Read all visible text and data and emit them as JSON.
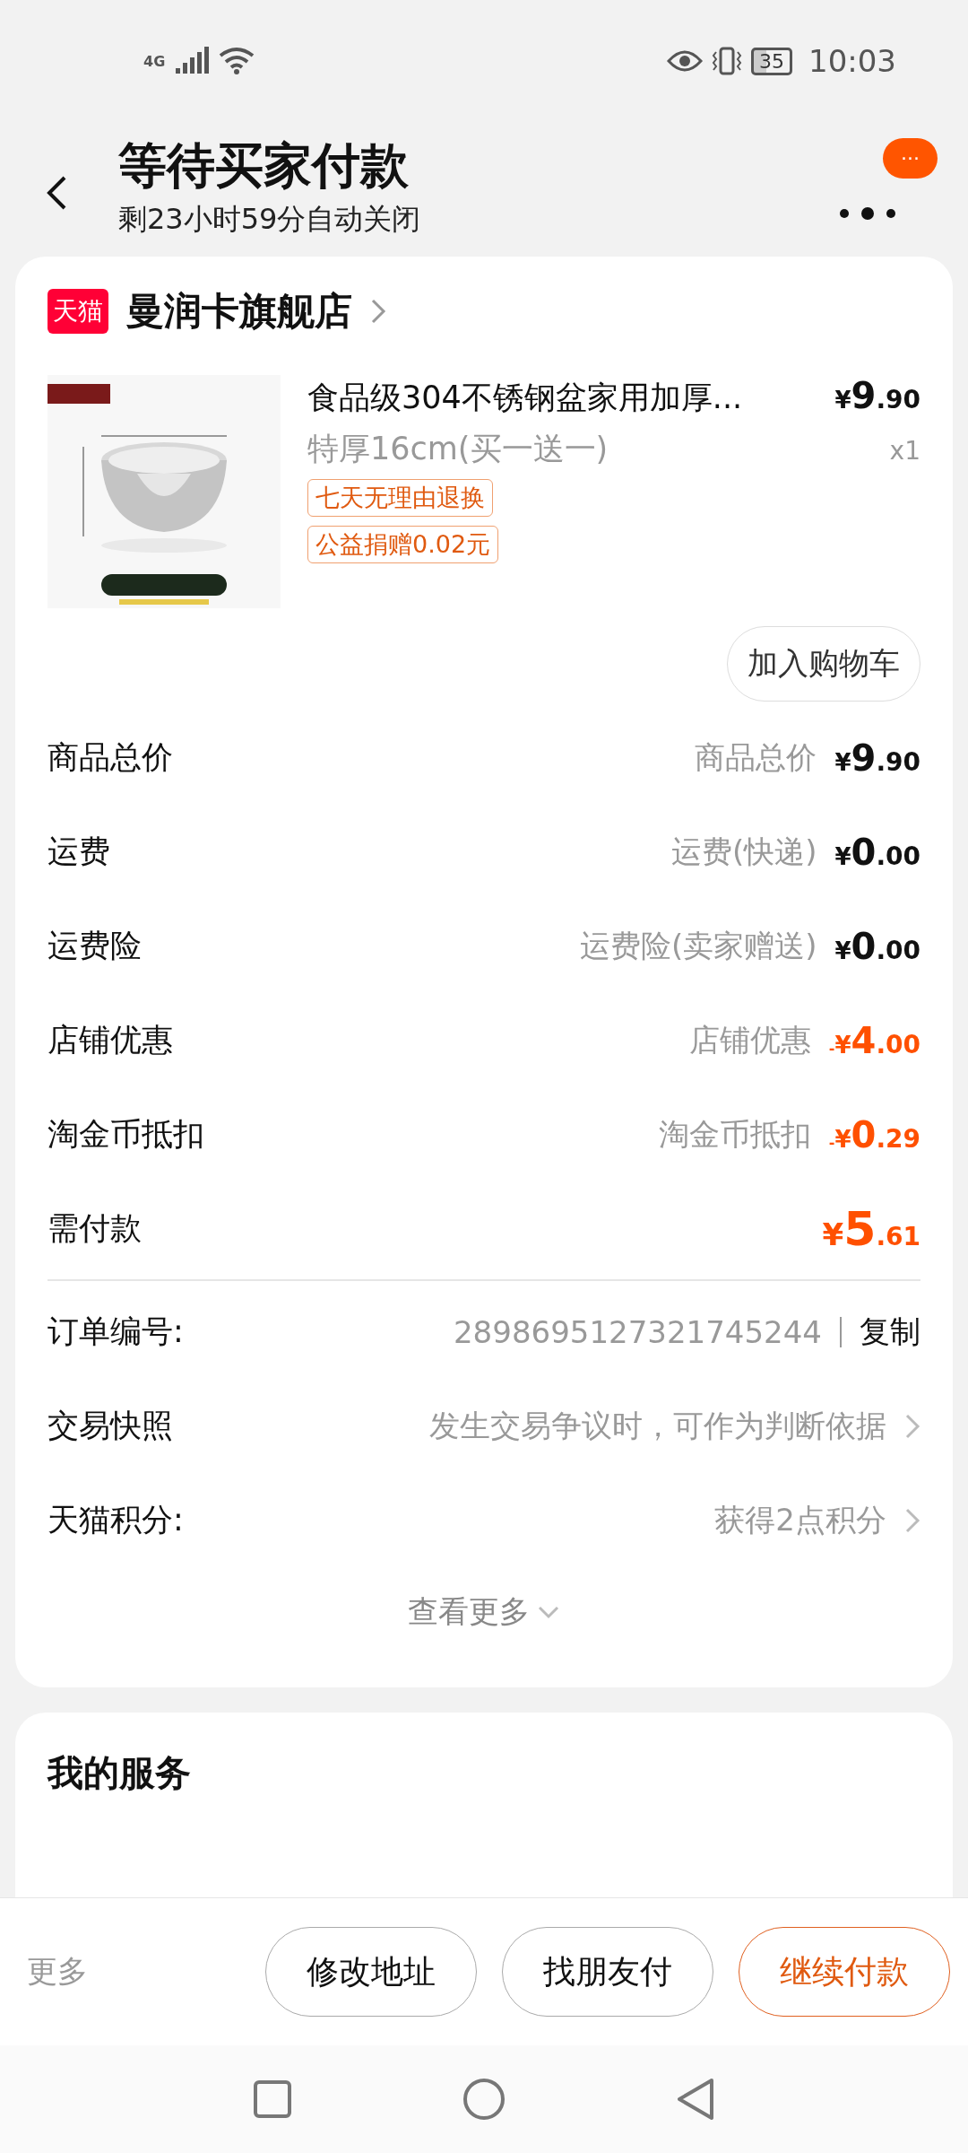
{
  "status_bar": {
    "network": "4G",
    "battery": "35",
    "time": "10:03"
  },
  "header": {
    "title": "等待买家付款",
    "subtitle": "剩23小时59分自动关闭",
    "more_badge": "···"
  },
  "store": {
    "logo": "天猫",
    "name": "曼润卡旗舰店"
  },
  "product": {
    "title": "食品级304不锈钢盆家用加厚...",
    "spec": "特厚16cm(买一送一)",
    "price": {
      "symbol": "¥",
      "integer": "9",
      "decimal": ".90"
    },
    "quantity": "x1",
    "tags": [
      "七天无理由退换",
      "公益捐赠0.02元"
    ],
    "cart_button": "加入购物车"
  },
  "price_rows": [
    {
      "label": "商品总价",
      "note": "商品总价",
      "kind": "normal",
      "amount": {
        "symbol": "¥",
        "integer": "9",
        "decimal": ".90"
      }
    },
    {
      "label": "运费",
      "note": "运费(快递)",
      "kind": "normal",
      "amount": {
        "symbol": "¥",
        "integer": "0",
        "decimal": ".00"
      }
    },
    {
      "label": "运费险",
      "note": "运费险(卖家赠送)",
      "kind": "normal",
      "amount": {
        "symbol": "¥",
        "integer": "0",
        "decimal": ".00"
      }
    },
    {
      "label": "店铺优惠",
      "note": "店铺优惠",
      "kind": "discount",
      "amount": {
        "sign": "-",
        "symbol": "¥",
        "integer": "4",
        "decimal": ".00"
      }
    },
    {
      "label": "淘金币抵扣",
      "note": "淘金币抵扣",
      "kind": "discount",
      "amount": {
        "sign": "-",
        "symbol": "¥",
        "integer": "0",
        "decimal": ".29"
      }
    },
    {
      "label": "需付款",
      "kind": "total",
      "amount": {
        "symbol": "¥",
        "integer": "5",
        "decimal": ".61"
      }
    }
  ],
  "info_rows": [
    {
      "label": "订单编号:",
      "value": "2898695127321745244",
      "action": "复制",
      "kind": "copy"
    },
    {
      "label": "交易快照",
      "value": "发生交易争议时，可作为判断依据",
      "kind": "link"
    },
    {
      "label": "天猫积分:",
      "value": "获得2点积分",
      "kind": "link"
    }
  ],
  "see_more": "查看更多",
  "services": {
    "title": "我的服务"
  },
  "bottom_bar": {
    "more": "更多",
    "buttons": [
      {
        "label": "修改地址",
        "primary": false
      },
      {
        "label": "找朋友付",
        "primary": false
      },
      {
        "label": "继续付款",
        "primary": true
      }
    ]
  }
}
